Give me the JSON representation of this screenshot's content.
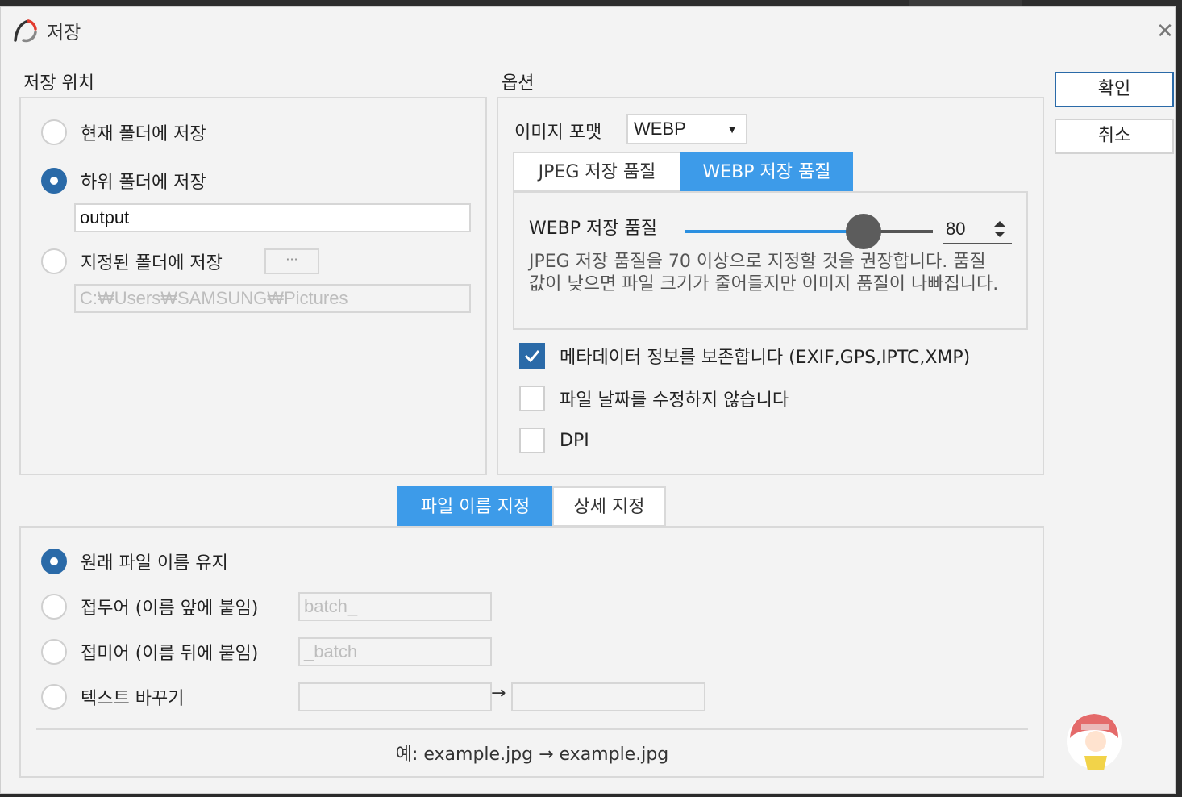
{
  "window": {
    "title": "저장",
    "icon": "app-logo-icon",
    "close_icon": "close-icon"
  },
  "location": {
    "heading": "저장 위치",
    "options": [
      {
        "label": "현재 폴더에 저장",
        "selected": false
      },
      {
        "label": "하위 폴더에 저장",
        "selected": true
      },
      {
        "label": "지정된 폴더에 저장",
        "selected": false
      }
    ],
    "subfolder_value": "output",
    "browse_label": "···",
    "folder_path": "C:₩Users₩SAMSUNG₩Pictures"
  },
  "options": {
    "heading": "옵션",
    "format_label": "이미지 포맷",
    "format_value": "WEBP",
    "quality_tabs": [
      {
        "label": "JPEG 저장 품질",
        "active": false
      },
      {
        "label": "WEBP 저장 품질",
        "active": true
      }
    ],
    "quality_label": "WEBP 저장 품질",
    "quality_value": "80",
    "quality_fraction": 0.72,
    "quality_desc": "JPEG 저장 품질을 70 이상으로 지정할 것을 권장합니다. 품질 값이 낮으면 파일 크기가 줄어들지만 이미지 품질이 나빠집니다.",
    "checks": [
      {
        "label": "메타데이터 정보를 보존합니다 (EXIF,GPS,IPTC,XMP)",
        "checked": true
      },
      {
        "label": "파일 날짜를 수정하지 않습니다",
        "checked": false
      },
      {
        "label": "DPI",
        "checked": false
      }
    ]
  },
  "actions": {
    "ok_label": "확인",
    "cancel_label": "취소"
  },
  "naming": {
    "tabs": [
      {
        "label": "파일 이름 지정",
        "active": true
      },
      {
        "label": "상세 지정",
        "active": false
      }
    ],
    "options": [
      {
        "label": "원래 파일 이름 유지",
        "selected": true
      },
      {
        "label": "접두어 (이름 앞에 붙임)",
        "selected": false
      },
      {
        "label": "접미어 (이름 뒤에 붙임)",
        "selected": false
      },
      {
        "label": "텍스트 바꾸기",
        "selected": false
      }
    ],
    "prefix_value": "batch_",
    "suffix_value": "_batch",
    "replace_from": "",
    "replace_to": "",
    "replace_arrow": "→",
    "example": "예: example.jpg → example.jpg"
  },
  "colors": {
    "accent": "#3d9be9",
    "radio_selected": "#2a6aa8",
    "panel_border": "#d9d9d9",
    "background": "#f3f3f3"
  }
}
